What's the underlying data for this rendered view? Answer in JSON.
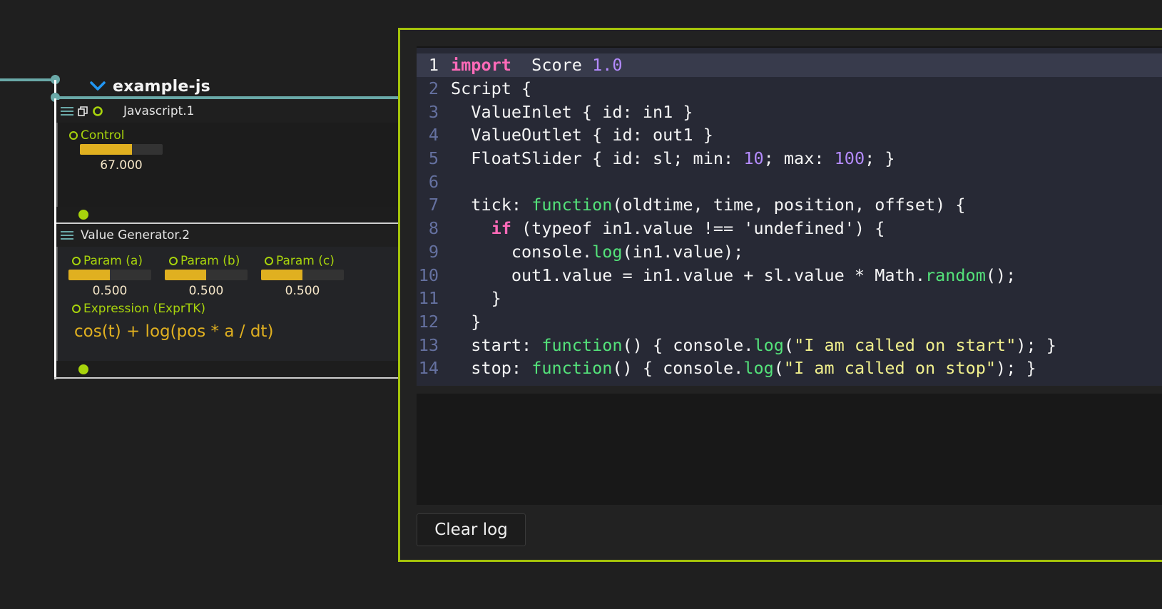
{
  "interval": {
    "title": "example-js",
    "chevron_icon": "chevron-down-icon"
  },
  "colors": {
    "accent_green": "#a8d40c",
    "cable": "#6aa9a8",
    "slider_fill": "#e0b020",
    "chevron_blue": "#2196f3",
    "editor_border": "#a4c20a"
  },
  "nodes": [
    {
      "title": "Javascript.1",
      "icons": [
        "menu-icon",
        "window-icon",
        "port-ring-icon"
      ],
      "controls": [
        {
          "label": "Control",
          "value_text": "67.000",
          "value": 67,
          "fill_fraction": 0.63
        }
      ]
    },
    {
      "title": "Value Generator.2",
      "icons": [
        "menu-icon"
      ],
      "controls": [
        {
          "label": "Param (a)",
          "value_text": "0.500",
          "value": 0.5,
          "fill_fraction": 0.5
        },
        {
          "label": "Param (b)",
          "value_text": "0.500",
          "value": 0.5,
          "fill_fraction": 0.5
        },
        {
          "label": "Param (c)",
          "value_text": "0.500",
          "value": 0.5,
          "fill_fraction": 0.5
        }
      ],
      "expression": {
        "label": "Expression (ExprTK)",
        "value": "cos(t) + log(pos * a / dt)"
      }
    }
  ],
  "editor": {
    "current_line": 1,
    "lines": [
      {
        "n": "1",
        "tokens": [
          [
            "kw",
            "import"
          ],
          [
            "",
            "  Score "
          ],
          [
            "num",
            "1.0"
          ]
        ]
      },
      {
        "n": "2",
        "tokens": [
          [
            "",
            "Script {"
          ]
        ]
      },
      {
        "n": "3",
        "tokens": [
          [
            "",
            "  ValueInlet { id: in1 }"
          ]
        ]
      },
      {
        "n": "4",
        "tokens": [
          [
            "",
            "  ValueOutlet { id: out1 }"
          ]
        ]
      },
      {
        "n": "5",
        "tokens": [
          [
            "",
            "  FloatSlider { id: sl; min: "
          ],
          [
            "num",
            "10"
          ],
          [
            "",
            "; max: "
          ],
          [
            "num",
            "100"
          ],
          [
            "",
            "; }"
          ]
        ]
      },
      {
        "n": "6",
        "tokens": []
      },
      {
        "n": "7",
        "tokens": [
          [
            "",
            "  tick: "
          ],
          [
            "fn",
            "function"
          ],
          [
            "",
            "(oldtime, time, position, offset) {"
          ]
        ]
      },
      {
        "n": "8",
        "tokens": [
          [
            "",
            "    "
          ],
          [
            "kw",
            "if"
          ],
          [
            "",
            " (typeof in1.value !== 'undefined') {"
          ]
        ]
      },
      {
        "n": "9",
        "tokens": [
          [
            "",
            "      console."
          ],
          [
            "fn",
            "log"
          ],
          [
            "",
            "(in1.value);"
          ]
        ]
      },
      {
        "n": "10",
        "tokens": [
          [
            "",
            "      out1.value = in1.value + sl.value * Math."
          ],
          [
            "fn",
            "random"
          ],
          [
            "",
            "();"
          ]
        ]
      },
      {
        "n": "11",
        "tokens": [
          [
            "",
            "    }"
          ]
        ]
      },
      {
        "n": "12",
        "tokens": [
          [
            "",
            "  }"
          ]
        ]
      },
      {
        "n": "13",
        "tokens": [
          [
            "",
            "  start: "
          ],
          [
            "fn",
            "function"
          ],
          [
            "",
            "() { console."
          ],
          [
            "fn",
            "log"
          ],
          [
            "",
            "("
          ],
          [
            "str",
            "\"I am called on start\""
          ],
          [
            "",
            "); }"
          ]
        ]
      },
      {
        "n": "14",
        "tokens": [
          [
            "",
            "  stop: "
          ],
          [
            "fn",
            "function"
          ],
          [
            "",
            "() { console."
          ],
          [
            "fn",
            "log"
          ],
          [
            "",
            "("
          ],
          [
            "str",
            "\"I am called on stop\""
          ],
          [
            "",
            "); }"
          ]
        ]
      }
    ],
    "log_text": "",
    "clear_log_label": "Clear log"
  }
}
